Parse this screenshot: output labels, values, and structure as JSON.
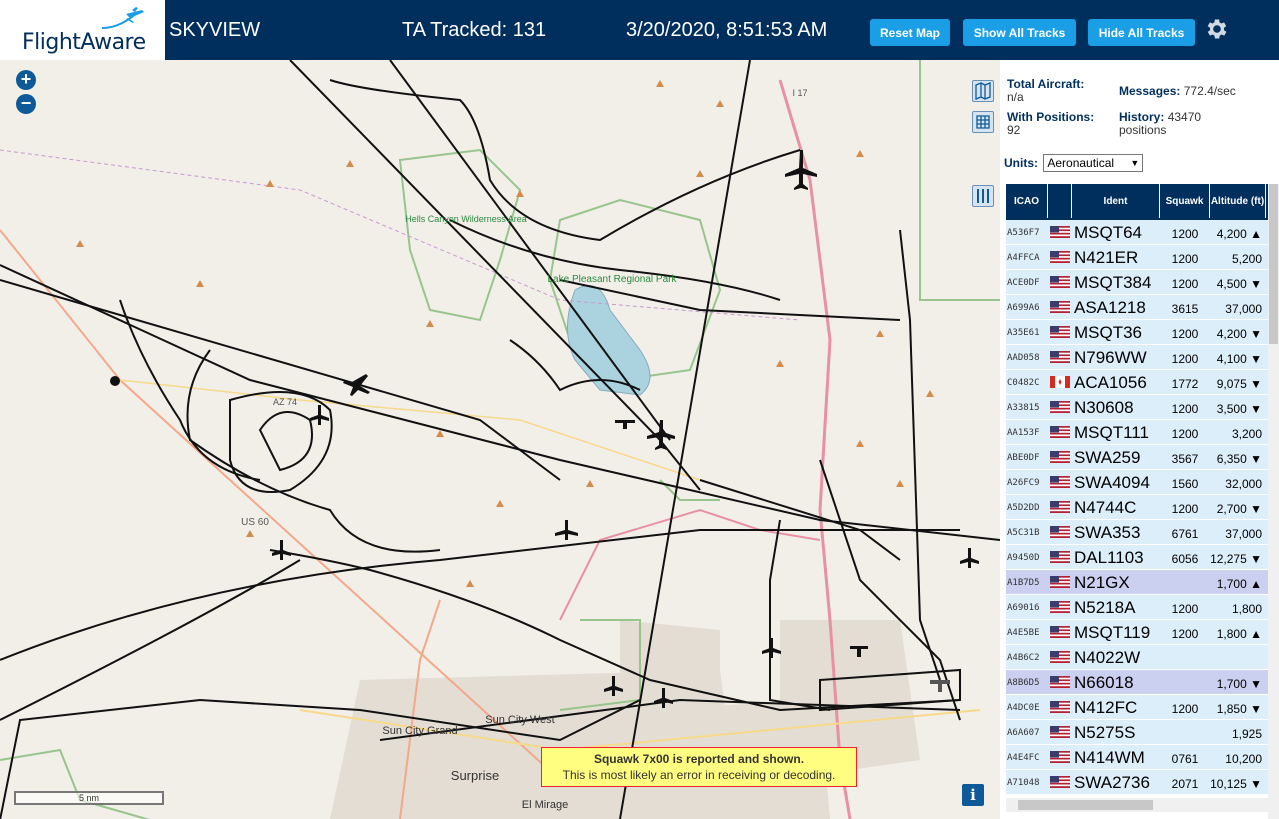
{
  "header": {
    "logo_text": "FlightAware",
    "title": "SKYVIEW",
    "tracked": "TA Tracked: 131",
    "datetime": "3/20/2020, 8:51:53 AM",
    "reset_label": "Reset Map",
    "show_label": "Show All Tracks",
    "hide_label": "Hide All Tracks"
  },
  "stats": {
    "total_label": "Total Aircraft:",
    "total_value": "n/a",
    "messages_label": "Messages:",
    "messages_value": "772.4/sec",
    "positions_label": "With Positions:",
    "positions_value": "92",
    "history_label": "History:",
    "history_value": "43470 positions"
  },
  "units": {
    "label": "Units:",
    "selected": "Aeronautical"
  },
  "table": {
    "headers": {
      "icao": "ICAO",
      "flag": "",
      "ident": "Ident",
      "squawk": "Squawk",
      "altitude": "Altitude (ft)"
    },
    "rows": [
      {
        "icao": "A536F7",
        "flag": "us",
        "ident": "MSQT64",
        "squawk": "1200",
        "alt": "4,200 ▲"
      },
      {
        "icao": "A4FFCA",
        "flag": "us",
        "ident": "N421ER",
        "squawk": "1200",
        "alt": "5,200"
      },
      {
        "icao": "ACE0DF",
        "flag": "us",
        "ident": "MSQT384",
        "squawk": "1200",
        "alt": "4,500 ▼"
      },
      {
        "icao": "A699A6",
        "flag": "us",
        "ident": "ASA1218",
        "squawk": "3615",
        "alt": "37,000"
      },
      {
        "icao": "A35E61",
        "flag": "us",
        "ident": "MSQT36",
        "squawk": "1200",
        "alt": "4,200 ▼"
      },
      {
        "icao": "AAD058",
        "flag": "us",
        "ident": "N796WW",
        "squawk": "1200",
        "alt": "4,100 ▼"
      },
      {
        "icao": "C0482C",
        "flag": "ca",
        "ident": "ACA1056",
        "squawk": "1772",
        "alt": "9,075 ▼"
      },
      {
        "icao": "A33815",
        "flag": "us",
        "ident": "N30608",
        "squawk": "1200",
        "alt": "3,500 ▼"
      },
      {
        "icao": "AA153F",
        "flag": "us",
        "ident": "MSQT111",
        "squawk": "1200",
        "alt": "3,200"
      },
      {
        "icao": "ABE0DF",
        "flag": "us",
        "ident": "SWA259",
        "squawk": "3567",
        "alt": "6,350 ▼"
      },
      {
        "icao": "A26FC9",
        "flag": "us",
        "ident": "SWA4094",
        "squawk": "1560",
        "alt": "32,000"
      },
      {
        "icao": "A5D2DD",
        "flag": "us",
        "ident": "N4744C",
        "squawk": "1200",
        "alt": "2,700 ▼"
      },
      {
        "icao": "A5C31B",
        "flag": "us",
        "ident": "SWA353",
        "squawk": "6761",
        "alt": "37,000"
      },
      {
        "icao": "A9450D",
        "flag": "us",
        "ident": "DAL1103",
        "squawk": "6056",
        "alt": "12,275 ▼"
      },
      {
        "icao": "A1B7D5",
        "flag": "us",
        "ident": "N21GX",
        "squawk": "",
        "alt": "1,700 ▲",
        "selected": true
      },
      {
        "icao": "A69016",
        "flag": "us",
        "ident": "N5218A",
        "squawk": "1200",
        "alt": "1,800"
      },
      {
        "icao": "A4E5BE",
        "flag": "us",
        "ident": "MSQT119",
        "squawk": "1200",
        "alt": "1,800 ▲"
      },
      {
        "icao": "A4B6C2",
        "flag": "us",
        "ident": "N4022W",
        "squawk": "",
        "alt": ""
      },
      {
        "icao": "A8B6D5",
        "flag": "us",
        "ident": "N66018",
        "squawk": "",
        "alt": "1,700 ▼",
        "selected": true
      },
      {
        "icao": "A4DC0E",
        "flag": "us",
        "ident": "N412FC",
        "squawk": "1200",
        "alt": "1,850 ▼"
      },
      {
        "icao": "A6A607",
        "flag": "us",
        "ident": "N5275S",
        "squawk": "",
        "alt": "1,925"
      },
      {
        "icao": "A4E4FC",
        "flag": "us",
        "ident": "N414WM",
        "squawk": "0761",
        "alt": "10,200"
      },
      {
        "icao": "A71048",
        "flag": "us",
        "ident": "SWA2736",
        "squawk": "2071",
        "alt": "10,125 ▼"
      }
    ]
  },
  "map": {
    "scale_label": "5 nm",
    "squawk_title": "Squawk 7x00 is reported and shown.",
    "squawk_sub": "This is most likely an error in receiving or decoding.",
    "info_label": "i",
    "labels": {
      "hells_canyon": "Hells Canyon Wilderness Area",
      "lake_pleasant": "Lake Pleasant Regional Park",
      "sun_city_west": "Sun City West",
      "sun_city_grand": "Sun City Grand",
      "surprise": "Surprise",
      "el_mirage": "El Mirage",
      "us60": "US 60",
      "az74": "AZ 74",
      "i17": "I 17"
    }
  },
  "colors": {
    "header_bg": "#002f5d",
    "button": "#1a9ee6",
    "row_bg": "#ddeefb",
    "row_selected": "#cbcff0",
    "map_bg": "#f2efe9"
  }
}
